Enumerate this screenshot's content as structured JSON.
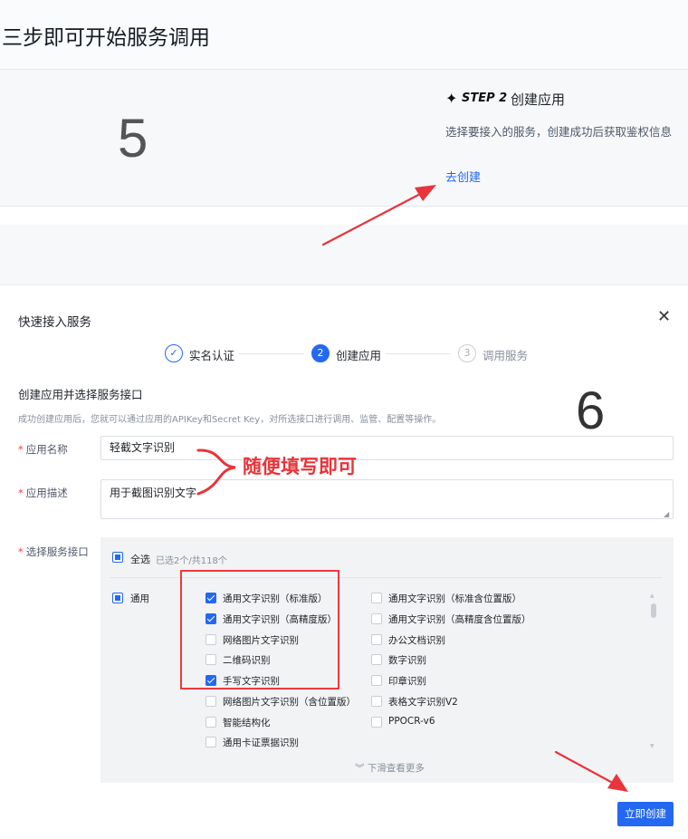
{
  "page": {
    "title": "三步即可开始服务调用"
  },
  "step_panel": {
    "step_label": "STEP 2",
    "step_name": "创建应用",
    "description": "选择要接入的服务，创建成功后获取鉴权信息",
    "link": "去创建"
  },
  "annotations": {
    "number_top": "5",
    "number_dialog": "6",
    "note": "随便填写即可",
    "colors": {
      "annotation_red": "#e8343a",
      "box_red": "#f0393d"
    }
  },
  "dialog": {
    "title": "快速接入服务",
    "close_icon": "close-icon",
    "steps": [
      {
        "num": "✓",
        "label": "实名认证",
        "state": "done"
      },
      {
        "num": "2",
        "label": "创建应用",
        "state": "active"
      },
      {
        "num": "3",
        "label": "调用服务",
        "state": "pending"
      }
    ],
    "section_title": "创建应用并选择服务接口",
    "section_desc": "成功创建应用后，您就可以通过应用的APIKey和Secret Key，对所选接口进行调用、监管、配置等操作。",
    "form": {
      "name_label": "应用名称",
      "name_value": "轻截文字识别",
      "desc_label": "应用描述",
      "desc_value": "用于截图识别文字",
      "service_label": "选择服务接口",
      "required_mark": "*"
    },
    "services": {
      "select_all": "全选",
      "count": "已选2个/共118个",
      "group": "通用",
      "left_items": [
        {
          "label": "通用文字识别（标准版）",
          "checked": true
        },
        {
          "label": "通用文字识别（高精度版）",
          "checked": true
        },
        {
          "label": "网络图片文字识别",
          "checked": false
        },
        {
          "label": "二维码识别",
          "checked": false
        },
        {
          "label": "手写文字识别",
          "checked": true
        },
        {
          "label": "网络图片文字识别（含位置版）",
          "checked": false
        },
        {
          "label": "智能结构化",
          "checked": false
        },
        {
          "label": "通用卡证票据识别",
          "checked": false
        }
      ],
      "right_items": [
        {
          "label": "通用文字识别（标准含位置版）",
          "checked": false
        },
        {
          "label": "通用文字识别（高精度含位置版）",
          "checked": false
        },
        {
          "label": "办公文档识别",
          "checked": false
        },
        {
          "label": "数字识别",
          "checked": false
        },
        {
          "label": "印章识别",
          "checked": false
        },
        {
          "label": "表格文字识别V2",
          "checked": false
        },
        {
          "label": "PPOCR-v6",
          "checked": false
        }
      ],
      "more": "下滑查看更多"
    },
    "submit": "立即创建",
    "accent": "#2468f2"
  }
}
